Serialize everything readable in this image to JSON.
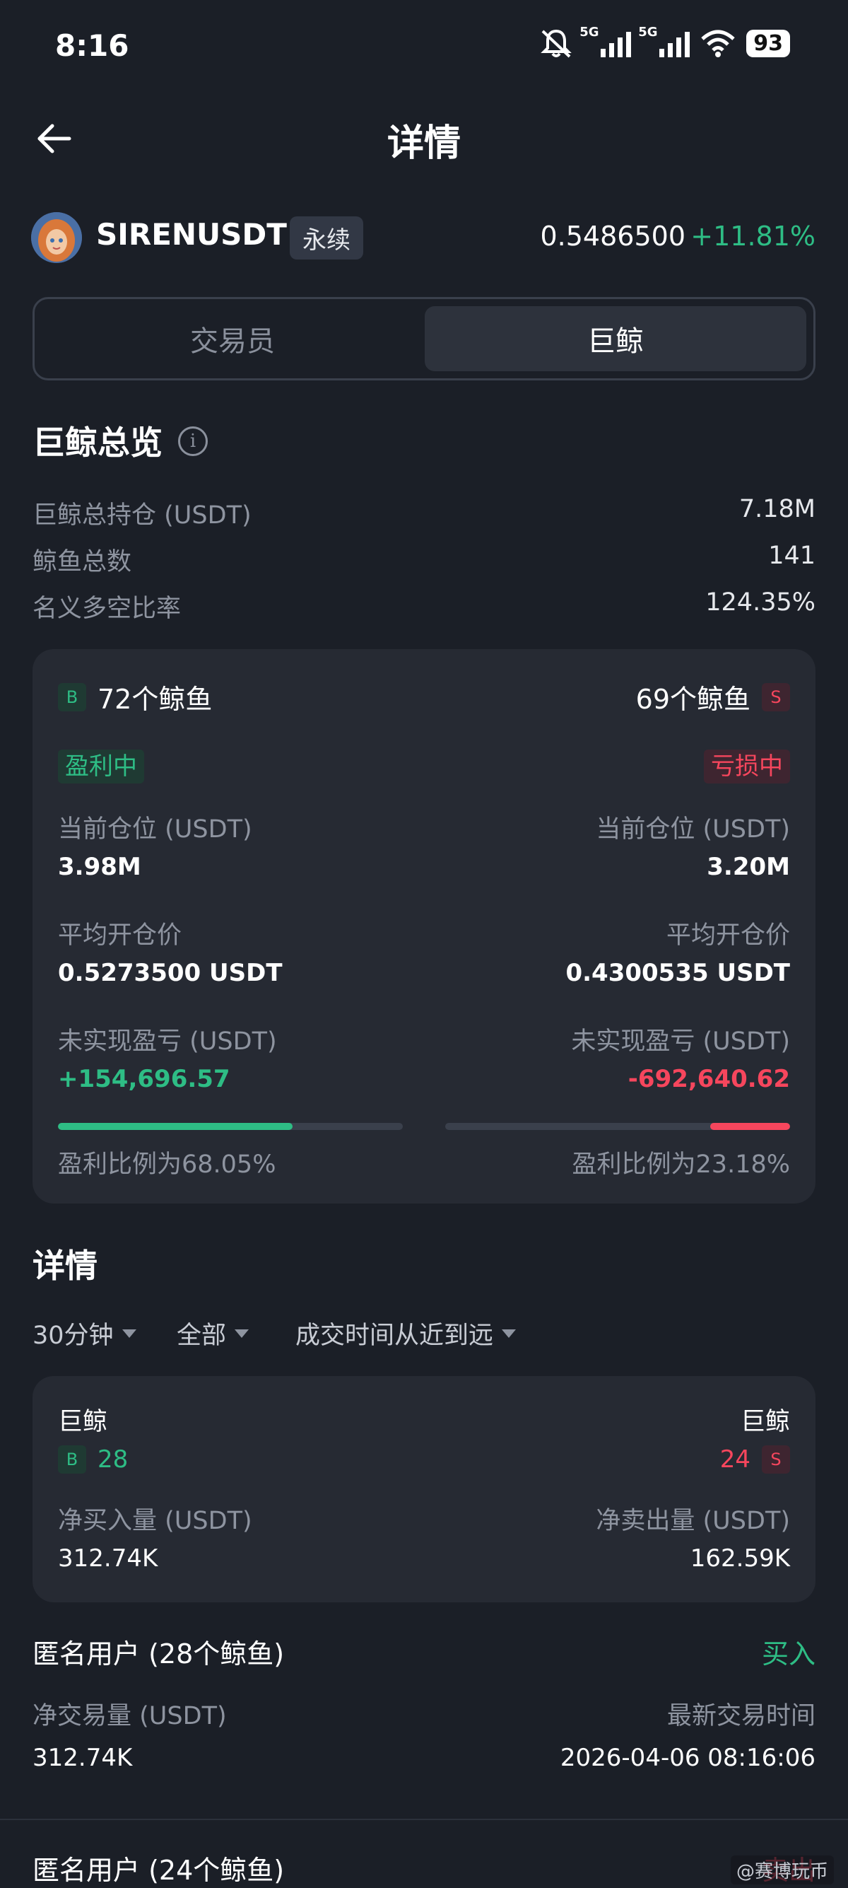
{
  "status": {
    "time": "8:16",
    "net1": "5G",
    "net2": "5G",
    "battery": "93"
  },
  "header": {
    "title": "详情"
  },
  "symbol": {
    "name": "SIRENUSDT",
    "badge": "永续",
    "price": "0.5486500",
    "change": "+11.81%"
  },
  "tabs": [
    {
      "label": "交易员",
      "selected": false
    },
    {
      "label": "巨鲸",
      "selected": true
    }
  ],
  "overview": {
    "title": "巨鲸总览",
    "rows": [
      {
        "label": "巨鲸总持仓 (USDT)",
        "value": "7.18M"
      },
      {
        "label": "鲸鱼总数",
        "value": "141"
      },
      {
        "label": "名义多空比率",
        "value": "124.35%"
      }
    ]
  },
  "long_short": {
    "long": {
      "badge": "B",
      "count_label": "72个鲸鱼",
      "status": "盈利中",
      "position_label": "当前仓位 (USDT)",
      "position": "3.98M",
      "avg_label": "平均开仓价",
      "avg": "0.5273500 USDT",
      "pnl_label": "未实现盈亏 (USDT)",
      "pnl": "+154,696.57",
      "ratio_label": "盈利比例为68.05%",
      "ratio": 0.6805
    },
    "short": {
      "badge": "S",
      "count_label": "69个鲸鱼",
      "status": "亏损中",
      "position_label": "当前仓位 (USDT)",
      "position": "3.20M",
      "avg_label": "平均开仓价",
      "avg": "0.4300535 USDT",
      "pnl_label": "未实现盈亏 (USDT)",
      "pnl": "-692,640.62",
      "ratio_label": "盈利比例为23.18%",
      "ratio": 0.2318
    }
  },
  "details": {
    "title": "详情",
    "filters": [
      "30分钟",
      "全部",
      "成交时间从近到远"
    ],
    "summary": {
      "left_title": "巨鲸",
      "left_badge": "B",
      "left_count": "28",
      "right_title": "巨鲸",
      "right_badge": "S",
      "right_count": "24",
      "buy_label": "净买入量 (USDT)",
      "buy_value": "312.74K",
      "sell_label": "净卖出量 (USDT)",
      "sell_value": "162.59K"
    },
    "entries": [
      {
        "title": "匿名用户 (28个鲸鱼)",
        "action": "买入",
        "vol_label": "净交易量 (USDT)",
        "vol": "312.74K",
        "time_label": "最新交易时间",
        "time": "2026-04-06 08:16:06"
      },
      {
        "title": "匿名用户 (24个鲸鱼)",
        "action": "卖出"
      }
    ]
  },
  "watermark": "@赛博玩币",
  "colors": {
    "bg": "#1b1f27",
    "card": "#262a33",
    "green": "#2ebd85",
    "red": "#f6465d"
  }
}
